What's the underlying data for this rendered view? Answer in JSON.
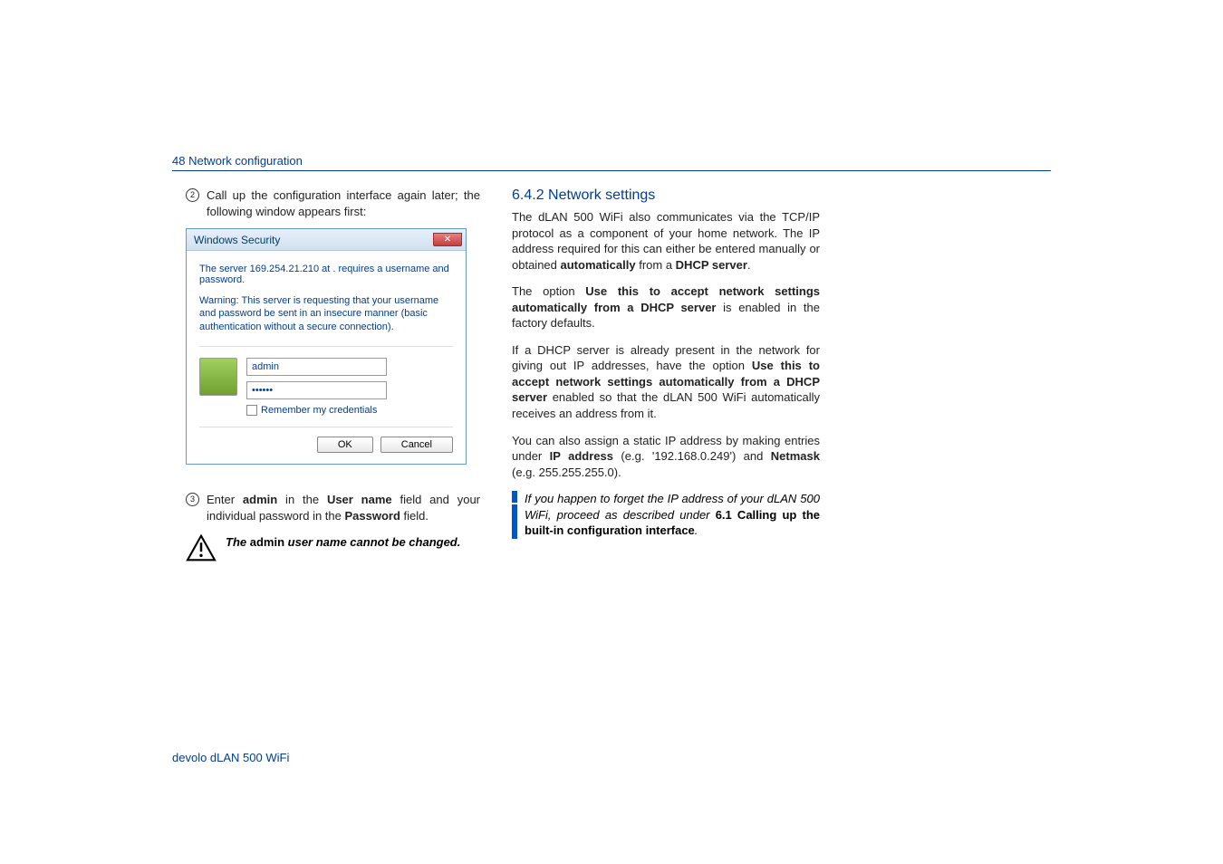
{
  "header": "48 Network configuration",
  "left": {
    "item2": "Call up the configuration interface again later; the following window appears first:",
    "dialog": {
      "title": "Windows Security",
      "server_line": "The server 169.254.21.210 at . requires a username and password.",
      "warning": "Warning: This server is requesting that your username and password be sent in an insecure manner (basic authentication without a secure connection).",
      "username": "admin",
      "password": "••••••",
      "remember": "Remember my credentials",
      "ok": "OK",
      "cancel": "Cancel"
    },
    "item3_a": "Enter ",
    "item3_b": "admin",
    "item3_c": " in the ",
    "item3_d": "User name",
    "item3_e": " field and your individual password in the ",
    "item3_f": "Password",
    "item3_g": " field.",
    "warn_a": "The ",
    "warn_b": "admin",
    "warn_c": " user name cannot be changed."
  },
  "right": {
    "heading": "6.4.2  Network settings",
    "p1_a": "The dLAN 500 WiFi also communicates via the TCP/IP protocol as a component of your home network. The IP address required for this can either be entered manually or obtained ",
    "p1_b": "automatically",
    "p1_c": " from a ",
    "p1_d": "DHCP server",
    "p1_e": ".",
    "p2_a": "The option ",
    "p2_b": "Use this to accept network settings automatically from a DHCP server",
    "p2_c": " is enabled in the factory defaults.",
    "p3_a": "If a DHCP server is already present in the network for giving out IP addresses, have the option ",
    "p3_b": "Use this to accept network settings automatically from a DHCP server",
    "p3_c": " enabled so that the dLAN 500 WiFi automatically receives an address from it.",
    "p4_a": "You can also assign a static IP address by making entries under ",
    "p4_b": "IP address",
    "p4_c": " (e.g. '192.168.0.249') and ",
    "p4_d": "Netmask",
    "p4_e": " (e.g. 255.255.255.0).",
    "note_a": "If you happen to forget the IP address of your dLAN 500 WiFi, proceed as described under ",
    "note_b": "6.1 Calling up the built-in configuration interface",
    "note_c": "."
  },
  "footer": "devolo dLAN 500 WiFi"
}
